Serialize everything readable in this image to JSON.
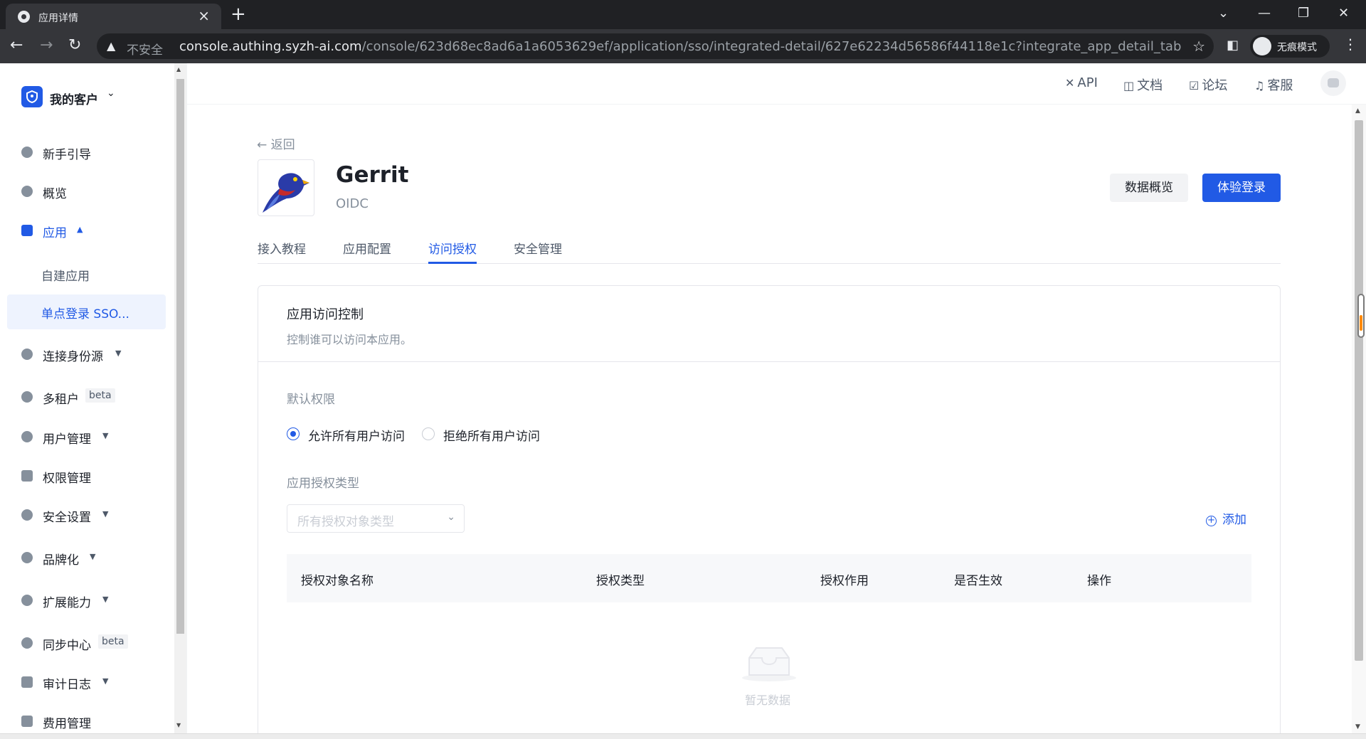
{
  "browser": {
    "tab_title": "应用详情",
    "insecure_label": "不安全",
    "url_host": "console.authing.syzh-ai.com",
    "url_path": "/console/623d68ec8ad6a1a6053629ef/application/sso/integrated-detail/627e62234d56586f44118e1c?integrate_app_detail_tab=assign_p...",
    "incognito_label": "无痕模式"
  },
  "sidebar": {
    "org_name": "我的客户",
    "items": [
      {
        "label": "新手引导"
      },
      {
        "label": "概览"
      },
      {
        "label": "应用"
      },
      {
        "label": "连接身份源"
      },
      {
        "label": "多租户",
        "badge": "beta"
      },
      {
        "label": "用户管理"
      },
      {
        "label": "权限管理"
      },
      {
        "label": "安全设置"
      },
      {
        "label": "品牌化"
      },
      {
        "label": "扩展能力"
      },
      {
        "label": "同步中心",
        "badge": "beta"
      },
      {
        "label": "审计日志"
      },
      {
        "label": "费用管理"
      }
    ],
    "sub_items": [
      "自建应用",
      "单点登录 SSO..."
    ]
  },
  "header": {
    "links": [
      "API",
      "文档",
      "论坛",
      "客服"
    ]
  },
  "app": {
    "back_label": "返回",
    "name": "Gerrit",
    "protocol": "OIDC",
    "overview_button": "数据概览",
    "trial_button": "体验登录"
  },
  "tabs": [
    "接入教程",
    "应用配置",
    "访问授权",
    "安全管理"
  ],
  "active_tab_index": 2,
  "access_control": {
    "title": "应用访问控制",
    "description": "控制谁可以访问本应用。",
    "default_permission_label": "默认权限",
    "radio_allow": "允许所有用户访问",
    "radio_deny": "拒绝所有用户访问",
    "selected_radio": "allow",
    "auth_type_label": "应用授权类型",
    "select_placeholder": "所有授权对象类型",
    "add_label": "添加",
    "table_headers": [
      "授权对象名称",
      "授权类型",
      "授权作用",
      "是否生效",
      "操作"
    ],
    "empty_text": "暂无数据"
  },
  "colors": {
    "accent": "#215ae5",
    "text_primary": "#1d2129",
    "text_secondary": "#86909c",
    "border": "#e5e6eb"
  }
}
